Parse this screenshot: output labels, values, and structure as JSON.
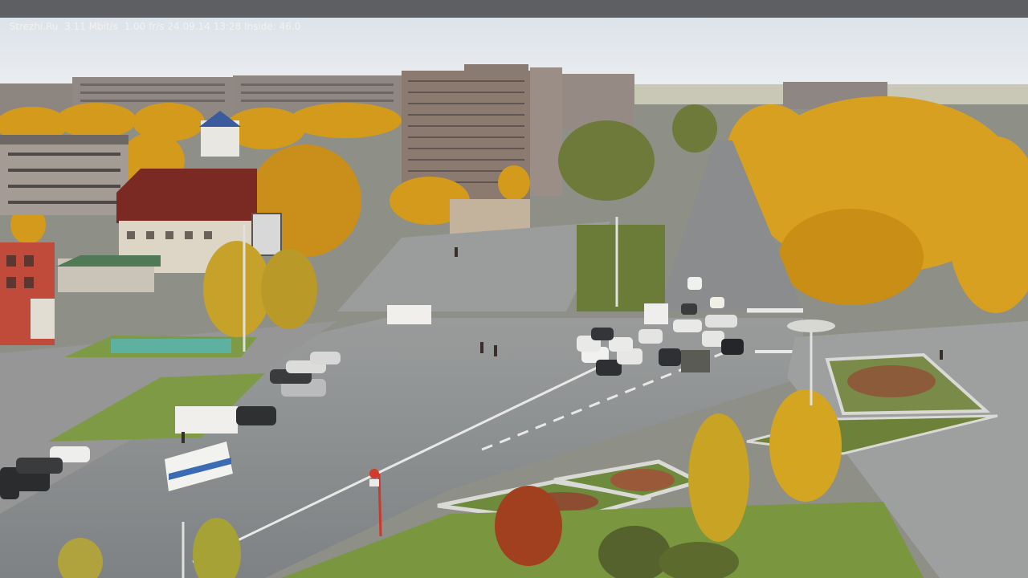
{
  "osd": {
    "text": "Strezhi.Ru  3.11 Mbit/s  1.00 fr/s 24.09.14 13:28 Inside: 46.0"
  },
  "colors": {
    "sky": "#e6eaee",
    "asphalt": "#8c9092",
    "foliage": "#d9a21f",
    "grass": "#6f8a3a",
    "osd_bar": "#5d5f62",
    "osd_text": "#f2f2f2"
  },
  "scene": {
    "description_icon": "camera-feed-icon"
  }
}
